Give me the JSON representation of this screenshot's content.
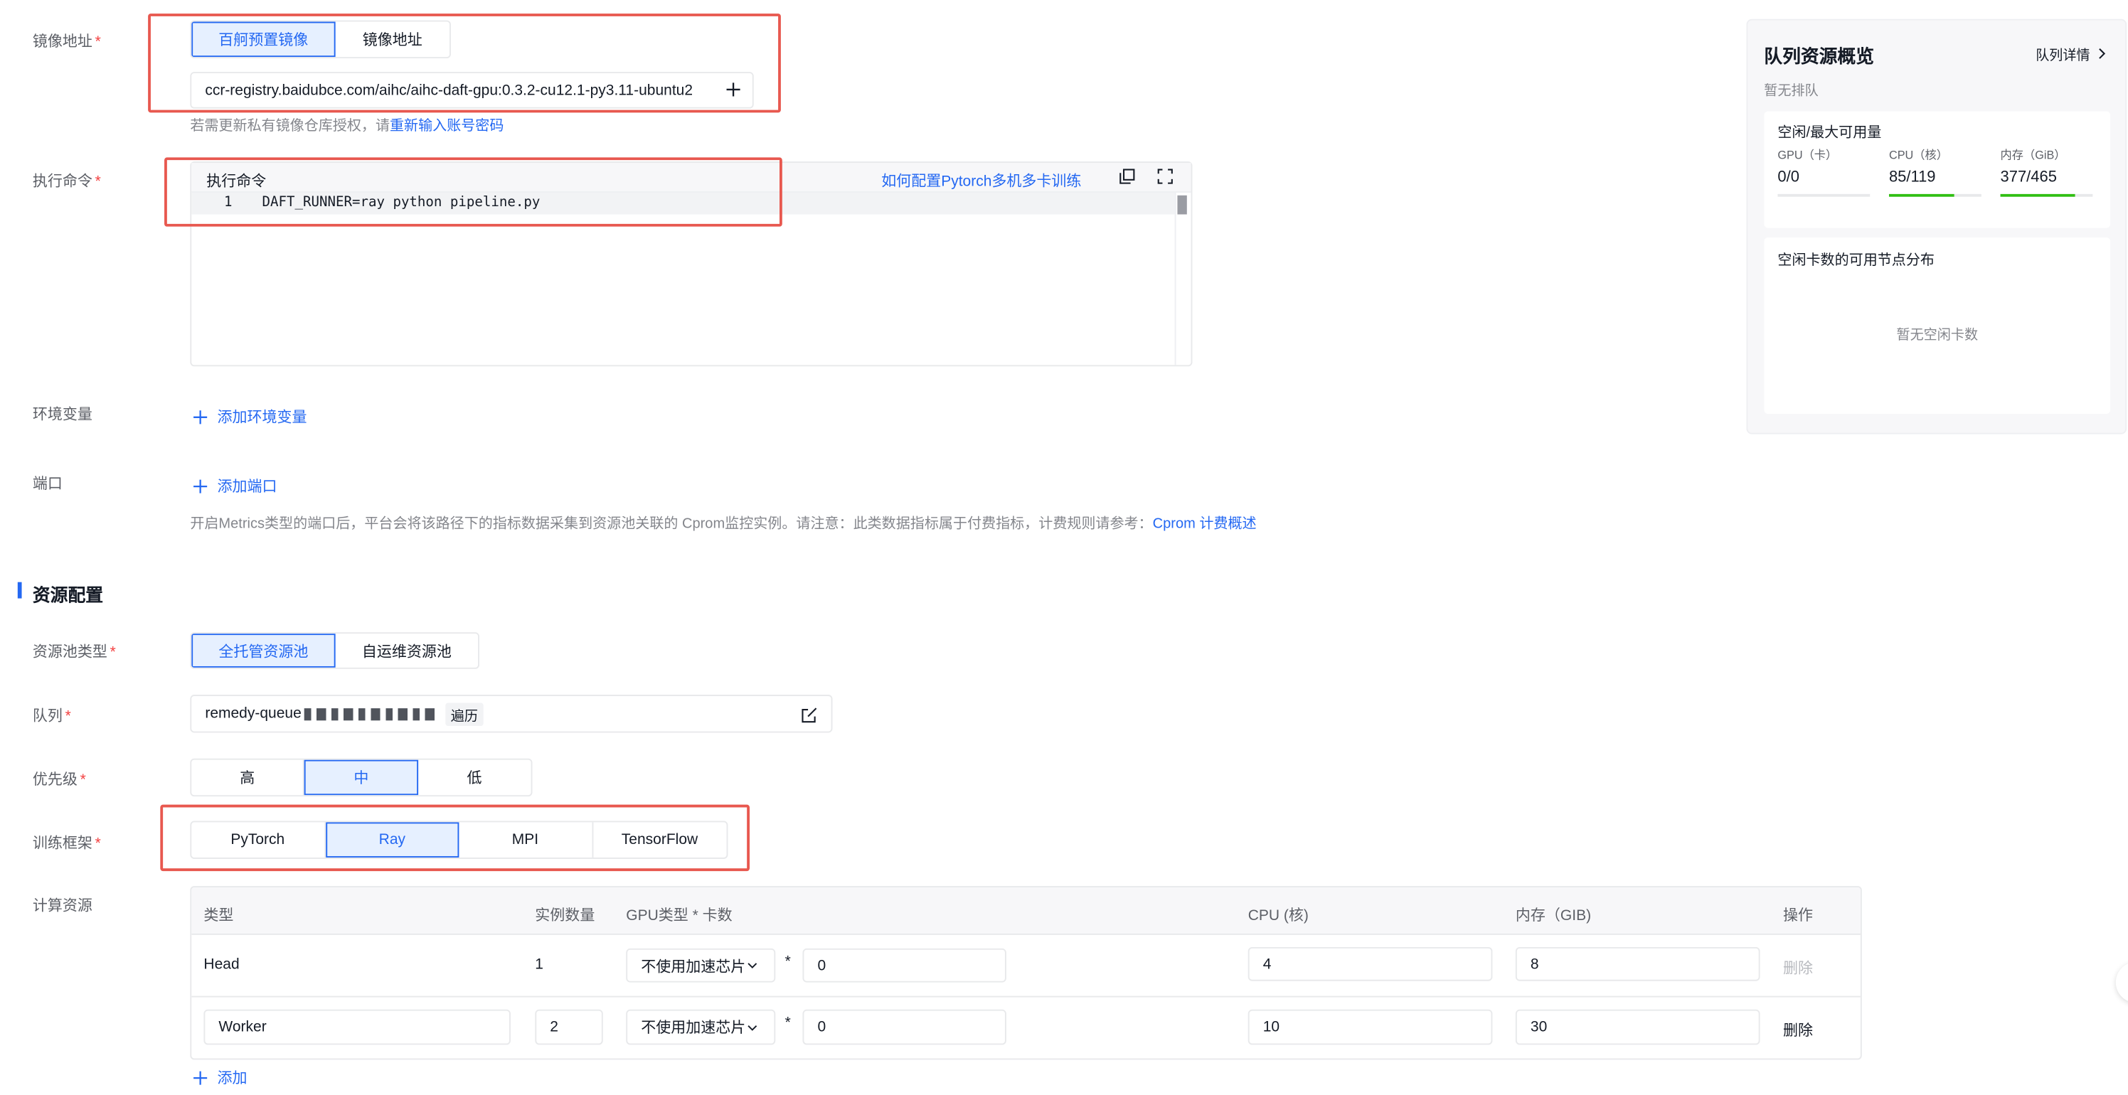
{
  "image_section": {
    "label": "镜像地址",
    "tabs": [
      "百舸预置镜像",
      "镜像地址"
    ],
    "image_value": "ccr-registry.baidubce.com/aihc/aihc-daft-gpu:0.3.2-cu12.1-py3.11-ubuntu2",
    "hint_prefix": "若需更新私有镜像仓库授权，请",
    "hint_link": "重新输入账号密码"
  },
  "command_section": {
    "label": "执行命令",
    "editor_title": "执行命令",
    "help_link": "如何配置Pytorch多机多卡训练",
    "line_number": "1",
    "code_line": "DAFT_RUNNER=ray python pipeline.py"
  },
  "env_section": {
    "label": "环境变量",
    "add_label": "添加环境变量"
  },
  "port_section": {
    "label": "端口",
    "add_label": "添加端口",
    "hint": "开启Metrics类型的端口后，平台会将该路径下的指标数据采集到资源池关联的 Cprom监控实例。请注意：此类数据指标属于付费指标，计费规则请参考：",
    "hint_link": "Cprom 计费概述"
  },
  "resource_section": {
    "title": "资源配置",
    "pool_type_label": "资源池类型",
    "pool_types": [
      "全托管资源池",
      "自运维资源池"
    ],
    "queue_label": "队列",
    "queue_value": "remedy-queue",
    "queue_tag": "遍历",
    "priority_label": "优先级",
    "priorities": [
      "高",
      "中",
      "低"
    ],
    "framework_label": "训练框架",
    "frameworks": [
      "PyTorch",
      "Ray",
      "MPI",
      "TensorFlow"
    ],
    "compute_label": "计算资源",
    "table": {
      "headers": [
        "类型",
        "实例数量",
        "GPU类型 * 卡数",
        "CPU (核)",
        "内存（GIB)",
        "操作"
      ],
      "rows": [
        {
          "type": "Head",
          "count": "1",
          "gpu_type": "不使用加速芯片",
          "gpu_count": "0",
          "cpu": "4",
          "memory": "8",
          "action": "删除"
        },
        {
          "type": "Worker",
          "count": "2",
          "gpu_type": "不使用加速芯片",
          "gpu_count": "0",
          "cpu": "10",
          "memory": "30",
          "action": "删除"
        }
      ]
    },
    "add_label": "添加"
  },
  "queue_panel": {
    "title": "队列资源概览",
    "detail_link": "队列详情",
    "status": "暂无排队",
    "usage_title": "空闲/最大可用量",
    "metrics": [
      {
        "label": "GPU（卡）",
        "value": "0/0",
        "fill": 0
      },
      {
        "label": "CPU（核）",
        "value": "85/119",
        "fill": 0.71
      },
      {
        "label": "内存（GiB）",
        "value": "377/465",
        "fill": 0.81
      }
    ],
    "distribution_title": "空闲卡数的可用节点分布",
    "distribution_empty": "暂无空闲卡数"
  },
  "colors": {
    "accent": "#2468f2",
    "required": "#f33e3e",
    "progress": "#30bf13",
    "annotation": "#e8584f"
  }
}
